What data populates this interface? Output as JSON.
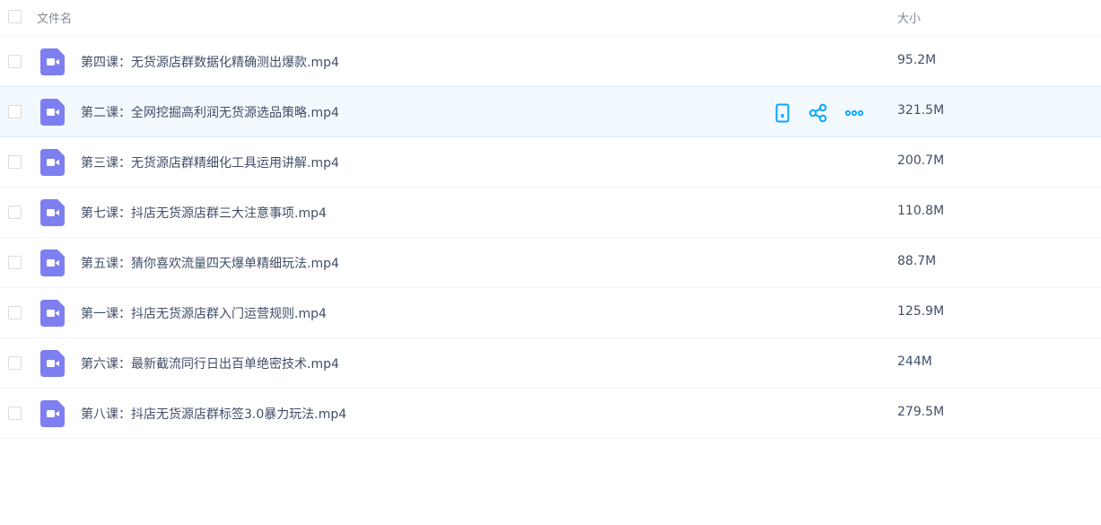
{
  "header": {
    "name_label": "文件名",
    "size_label": "大小"
  },
  "files": [
    {
      "name": "第四课：无货源店群数据化精确测出爆款.mp4",
      "size": "95.2M"
    },
    {
      "name": "第二课：全网挖掘高利润无货源选品策略.mp4",
      "size": "321.5M"
    },
    {
      "name": "第三课：无货源店群精细化工具运用讲解.mp4",
      "size": "200.7M"
    },
    {
      "name": "第七课：抖店无货源店群三大注意事项.mp4",
      "size": "110.8M"
    },
    {
      "name": "第五课：猜你喜欢流量四天爆单精细玩法.mp4",
      "size": "88.7M"
    },
    {
      "name": "第一课：抖店无货源店群入门运营规则.mp4",
      "size": "125.9M"
    },
    {
      "name": "第六课：最新截流同行日出百单绝密技术.mp4",
      "size": "244M"
    },
    {
      "name": "第八课：抖店无货源店群标签3.0暴力玩法.mp4",
      "size": "279.5M"
    }
  ],
  "hover_actions": {
    "icons": [
      "phone-icon",
      "share-icon",
      "more-icon"
    ],
    "color": "#06a7ff"
  },
  "colors": {
    "video_icon": "#7d7ff1",
    "hover_row_bg": "#f3faff"
  }
}
